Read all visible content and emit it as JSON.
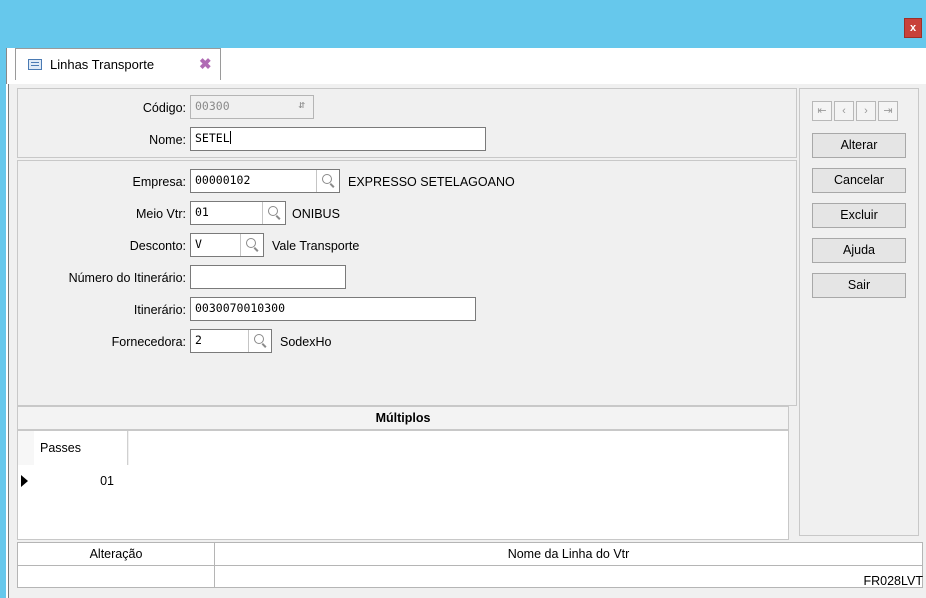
{
  "window": {
    "close_label": "x"
  },
  "tab": {
    "label": "Linhas Transporte",
    "close_icon": "close-x-icon"
  },
  "form": {
    "codigo": {
      "label": "Código:",
      "value": "00300"
    },
    "nome": {
      "label": "Nome:",
      "value": "SETEL"
    },
    "empresa": {
      "label": "Empresa:",
      "value": "00000102",
      "desc": "EXPRESSO SETELAGOANO"
    },
    "meio_vtr": {
      "label": "Meio Vtr:",
      "value": "01",
      "desc": "ONIBUS"
    },
    "desconto": {
      "label": "Desconto:",
      "value": "V",
      "desc": "Vale Transporte"
    },
    "numero_itinerario": {
      "label": "Número do Itinerário:",
      "value": ""
    },
    "itinerario": {
      "label": "Itinerário:",
      "value": "0030070010300"
    },
    "fornecedora": {
      "label": "Fornecedora:",
      "value": "2",
      "desc": "SodexHo"
    }
  },
  "nav_icons": [
    "first-record-icon",
    "prev-record-icon",
    "next-record-icon",
    "last-record-icon"
  ],
  "actions": {
    "alterar": "Alterar",
    "cancelar": "Cancelar",
    "excluir": "Excluir",
    "ajuda": "Ajuda",
    "sair": "Sair"
  },
  "multiplos": {
    "title": "Múltiplos",
    "column": "Passes",
    "rows": [
      "01"
    ]
  },
  "bottom_table": {
    "col1": "Alteração",
    "col2": "Nome da Linha do Vtr"
  },
  "status": {
    "form_code": "FR028LVT"
  },
  "colors": {
    "titlebar": "#66c8ec",
    "close": "#c8413a",
    "panel": "#f0f0f0"
  }
}
